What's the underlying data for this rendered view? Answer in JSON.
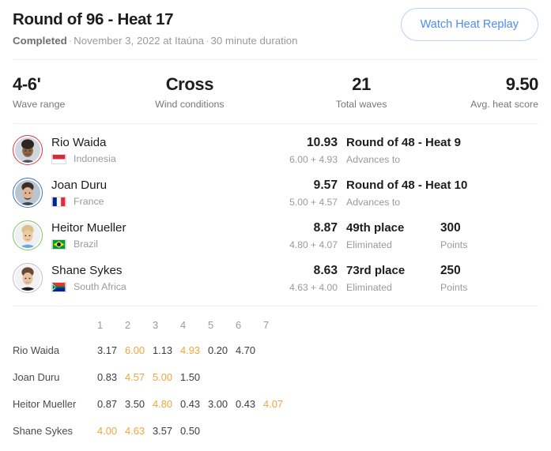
{
  "header": {
    "title": "Round of 96 - Heat 17",
    "status": "Completed",
    "date": "November 3, 2022 at Itaúna",
    "duration": "30 minute duration",
    "separator": "·",
    "replay_button": "Watch Heat Replay",
    "accent_color": "#4a8cf7",
    "border_color": "#b9d2f7"
  },
  "stats": [
    {
      "value": "4-6'",
      "label": "Wave range"
    },
    {
      "value": "Cross",
      "label": "Wind conditions"
    },
    {
      "value": "21",
      "label": "Total waves"
    },
    {
      "value": "9.50",
      "label": "Avg. heat score"
    }
  ],
  "surfers": [
    {
      "name": "Rio Waida",
      "country": "Indonesia",
      "flag": "indonesia-flag",
      "ring_color": "#e0393e",
      "total": "10.93",
      "parts": "6.00 + 4.93",
      "result": "Round of 48 - Heat 9",
      "result_sub": "Advances to",
      "points": "",
      "points_label": ""
    },
    {
      "name": "Joan Duru",
      "country": "France",
      "flag": "france-flag",
      "ring_color": "#3b74c4",
      "total": "9.57",
      "parts": "5.00 + 4.57",
      "result": "Round of 48 - Heat 10",
      "result_sub": "Advances to",
      "points": "",
      "points_label": ""
    },
    {
      "name": "Heitor Mueller",
      "country": "Brazil",
      "flag": "brazil-flag",
      "ring_color": "#7ec36a",
      "total": "8.87",
      "parts": "4.80 + 4.07",
      "result": "49th place",
      "result_sub": "Eliminated",
      "points": "300",
      "points_label": "Points"
    },
    {
      "name": "Shane Sykes",
      "country": "South Africa",
      "flag": "southafrica-flag",
      "ring_color": "#c9b6d8",
      "total": "8.63",
      "parts": "4.63 + 4.00",
      "result": "73rd place",
      "result_sub": "Eliminated",
      "points": "250",
      "points_label": "Points"
    }
  ],
  "wave_table": {
    "columns": [
      "1",
      "2",
      "3",
      "4",
      "5",
      "6",
      "7"
    ],
    "highlight_color": "#f2a53c",
    "rows": [
      {
        "name": "Rio Waida",
        "scores": [
          "3.17",
          "6.00",
          "1.13",
          "4.93",
          "0.20",
          "4.70",
          ""
        ],
        "highlight": [
          false,
          true,
          false,
          true,
          false,
          false,
          false
        ]
      },
      {
        "name": "Joan Duru",
        "scores": [
          "0.83",
          "4.57",
          "5.00",
          "1.50",
          "",
          "",
          ""
        ],
        "highlight": [
          false,
          true,
          true,
          false,
          false,
          false,
          false
        ]
      },
      {
        "name": "Heitor Mueller",
        "scores": [
          "0.87",
          "3.50",
          "4.80",
          "0.43",
          "3.00",
          "0.43",
          "4.07"
        ],
        "highlight": [
          false,
          false,
          true,
          false,
          false,
          false,
          true
        ]
      },
      {
        "name": "Shane Sykes",
        "scores": [
          "4.00",
          "4.63",
          "3.57",
          "0.50",
          "",
          "",
          ""
        ],
        "highlight": [
          true,
          true,
          false,
          false,
          false,
          false,
          false
        ]
      }
    ]
  }
}
